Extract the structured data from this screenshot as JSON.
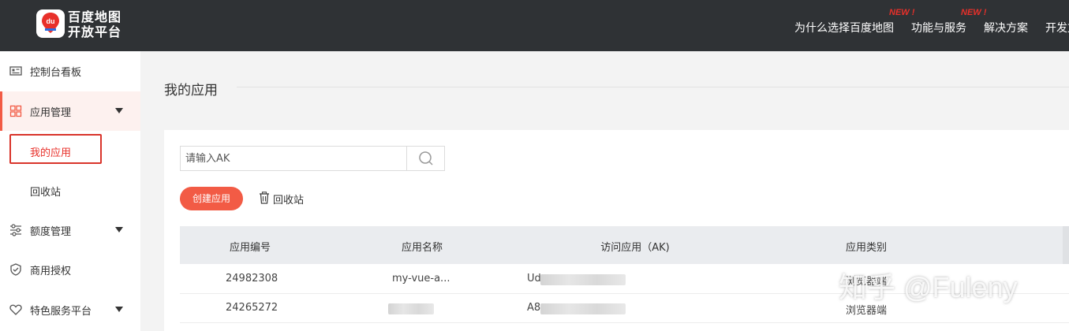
{
  "header": {
    "logo_line1": "百度地图",
    "logo_line2": "开放平台",
    "logo_badge": "du",
    "nav": [
      {
        "label": "为什么选择百度地图"
      },
      {
        "label": "功能与服务",
        "tag": "NEW !"
      },
      {
        "label": "解决方案",
        "tag": "NEW !"
      },
      {
        "label": "开发文"
      }
    ]
  },
  "sidebar": {
    "items": [
      {
        "label": "控制台看板",
        "icon": "dashboard-icon"
      },
      {
        "label": "应用管理",
        "icon": "grid-icon",
        "expanded": true
      },
      {
        "label": "额度管理",
        "icon": "sliders-icon",
        "expanded": false
      },
      {
        "label": "商用授权",
        "icon": "shield-icon"
      },
      {
        "label": "特色服务平台",
        "icon": "heart-icon",
        "expanded": false
      }
    ],
    "sub_items": [
      {
        "label": "我的应用",
        "active": true
      },
      {
        "label": "回收站"
      }
    ]
  },
  "main": {
    "title": "我的应用",
    "search": {
      "placeholder": "请输入AK",
      "value": ""
    },
    "create_button": "创建应用",
    "recycle_button": "回收站",
    "table": {
      "columns": [
        "应用编号",
        "应用名称",
        "访问应用（AK)",
        "应用类别"
      ],
      "rows": [
        {
          "id": "24982308",
          "name": "my-vue-a...",
          "ak": "Ud",
          "category": "浏览器端"
        },
        {
          "id": "24265272",
          "name": "",
          "ak": "A8",
          "category": "浏览器端"
        }
      ]
    }
  },
  "watermark": "知乎 @Fuleny",
  "colors": {
    "accent": "#f25b45",
    "topbar": "#2f3235",
    "highlight": "#d9342b"
  }
}
